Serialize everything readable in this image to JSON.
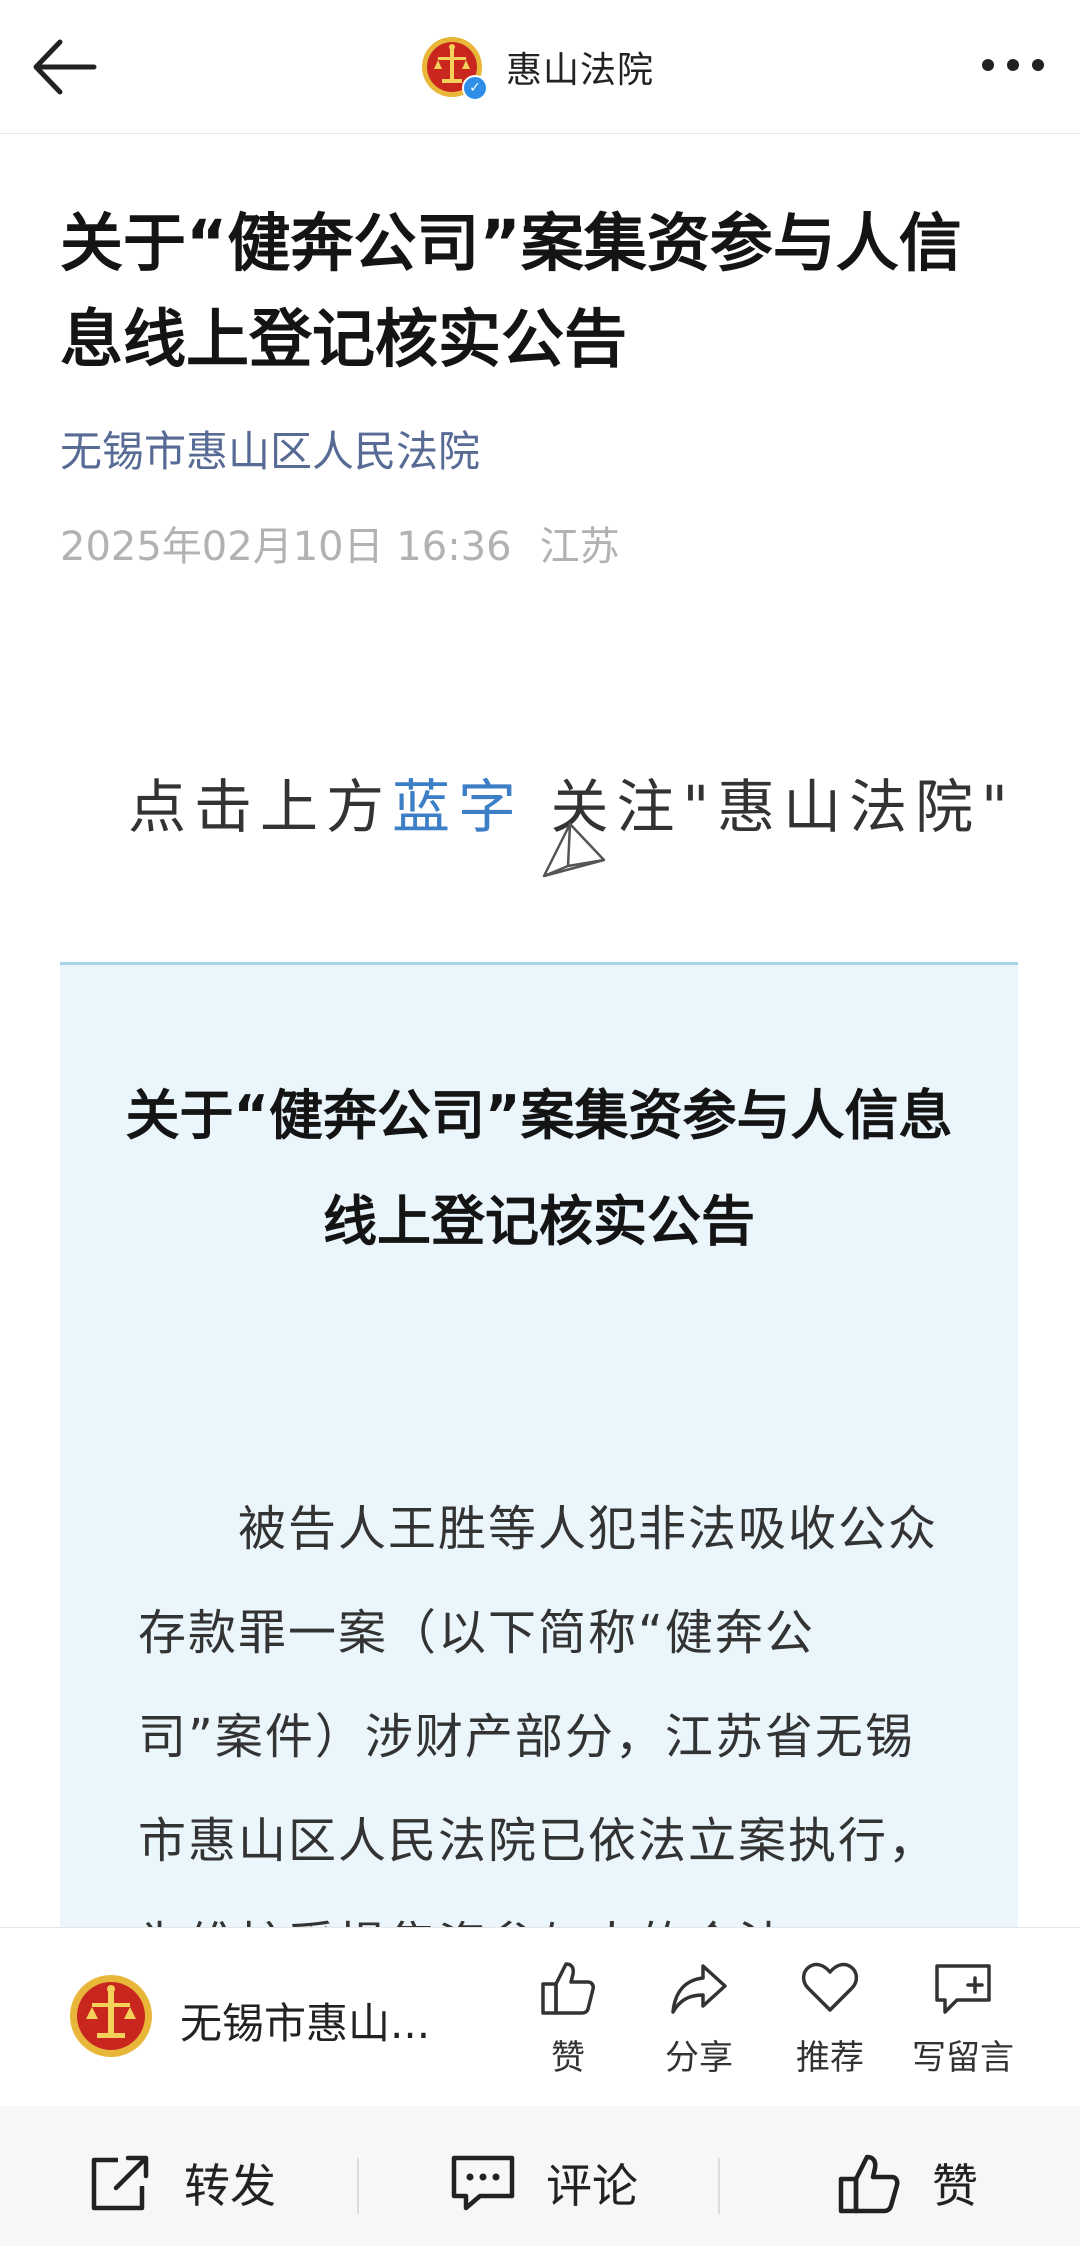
{
  "header": {
    "account_title": "惠山法院",
    "back_icon": "back-arrow-icon",
    "more_icon": "more-dots-icon"
  },
  "article": {
    "title": "关于“健奔公司”案集资参与人信息线上登记核实公告",
    "source": "无锡市惠山区人民法院",
    "date": "2025年02月10日 16:36",
    "location": "江苏"
  },
  "follow_banner": {
    "prefix": "点击上方",
    "highlight": "蓝字",
    "suffix": " 关注\"惠山法院\""
  },
  "notice": {
    "title_line1": "关于“健奔公司”案集资参与人信息",
    "title_line2": "线上登记核实公告",
    "body": "被告人王胜等人犯非法吸收公众存款罪一案（以下简称“健奔公司”案件）涉财产部分，江苏省无锡市惠山区人民法院已依法立案执行，为维护受损集资参与人的合法"
  },
  "interaction_bar": {
    "account_name": "无锡市惠山...",
    "actions": [
      {
        "label": "赞",
        "icon": "thumbs-up-icon"
      },
      {
        "label": "分享",
        "icon": "share-arrow-icon"
      },
      {
        "label": "推荐",
        "icon": "heart-icon"
      },
      {
        "label": "写留言",
        "icon": "comment-add-icon"
      }
    ]
  },
  "bottom_bar": {
    "forward": "转发",
    "comment": "评论",
    "like": "赞"
  },
  "colors": {
    "link_blue": "#576b95",
    "banner_blue": "#3d7fc7",
    "notice_bg": "#eaf6fc",
    "emblem_red": "#c8261f",
    "emblem_gold": "#e8b73a"
  }
}
